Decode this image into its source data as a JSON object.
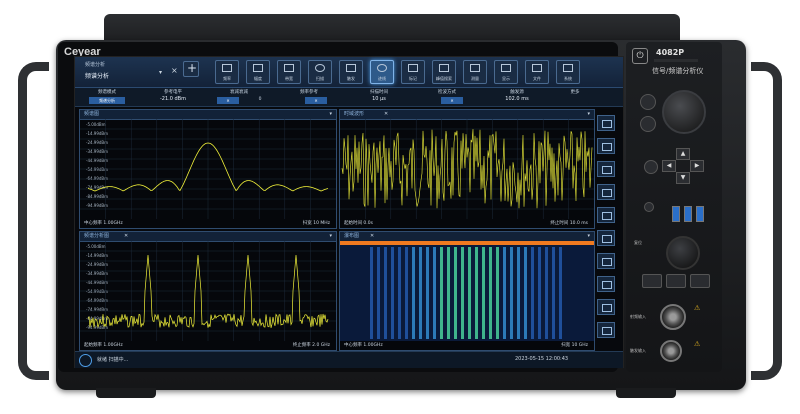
{
  "brand": "Ceyear",
  "model": "4082P",
  "subtitle": "信号/频谱分析仪",
  "toolbar": {
    "title_small": "频谱分析",
    "title_mode": "频谱分析",
    "icons": [
      {
        "name": "tool-1-icon",
        "label": "频率"
      },
      {
        "name": "tool-2-icon",
        "label": "幅度"
      },
      {
        "name": "tool-3-icon",
        "label": "带宽"
      },
      {
        "name": "tool-4-icon",
        "label": "扫描"
      },
      {
        "name": "tool-5-icon",
        "label": "触发"
      },
      {
        "name": "tool-6-icon",
        "label": "迹线"
      },
      {
        "name": "tool-7-icon",
        "label": "标记"
      },
      {
        "name": "tool-8-icon",
        "label": "峰值搜索"
      },
      {
        "name": "tool-9-icon",
        "label": "测量"
      },
      {
        "name": "tool-10-icon",
        "label": "显示"
      },
      {
        "name": "tool-11-icon",
        "label": "文件"
      },
      {
        "name": "tool-12-icon",
        "label": "系统"
      }
    ]
  },
  "status": {
    "cells": [
      {
        "label": "频谱模式",
        "value": "频谱分析"
      },
      {
        "label": "参考电平",
        "value": "-21.0 dBm"
      },
      {
        "label": "衰减衰减",
        "value": "0"
      },
      {
        "label": "频率参考",
        "value": "内"
      },
      {
        "label": "扫描时间",
        "value": "10 μs"
      },
      {
        "label": "检波方式",
        "value": "正峰"
      },
      {
        "label": "触发源",
        "value": "102.0 ms"
      },
      {
        "label": "更多",
        "value": "..."
      }
    ]
  },
  "panels": {
    "top_left": {
      "title": "频谱图",
      "footer_left": "中心频率 1.00GHz",
      "footer_right": "扫宽 10 MHz",
      "y_labels": [
        "-5.00dBm",
        "-14.99dBm",
        "-24.99dBm",
        "-34.99dBm",
        "-44.99dBm",
        "-54.99dBm",
        "-64.99dBm",
        "-74.99dBm",
        "-84.99dBm",
        "-94.99dBm"
      ]
    },
    "top_right": {
      "title": "时域波形",
      "footer_left": "起始时间 0.0s",
      "footer_right": "终止时间 10.0 ms"
    },
    "bottom_left": {
      "title": "频谱分析图",
      "footer_left": "起始频率 1.00GHz",
      "footer_right": "终止频率 2.0 GHz",
      "y_labels": [
        "-5.00dBm",
        "-14.99dBm",
        "-24.99dBm",
        "-34.99dBm",
        "-44.99dBm",
        "-54.99dBm",
        "-64.99dBm",
        "-74.99dBm",
        "-84.99dBm",
        "-94.99dBm"
      ]
    },
    "bottom_right": {
      "title": "瀑布图",
      "footer_left": "中心频率 1.00GHz",
      "footer_right": "扫宽 10 GHz"
    }
  },
  "bottom": {
    "left": "就绪 扫描中...",
    "right": "2023-05-15 12:00:43"
  },
  "side_icons": [
    "marker-icon",
    "peak-icon",
    "trace-icon",
    "save-icon",
    "print-icon",
    "config-icon",
    "zoom-icon",
    "window-icon",
    "layout-icon",
    "more-icon"
  ],
  "right_panel": {
    "preset_label": "复位",
    "rf_input": "射频输入",
    "trig": "触发输入",
    "warn": "⚠"
  },
  "colors": {
    "trace": "#f2f23a",
    "accent": "#4f9ee8"
  }
}
